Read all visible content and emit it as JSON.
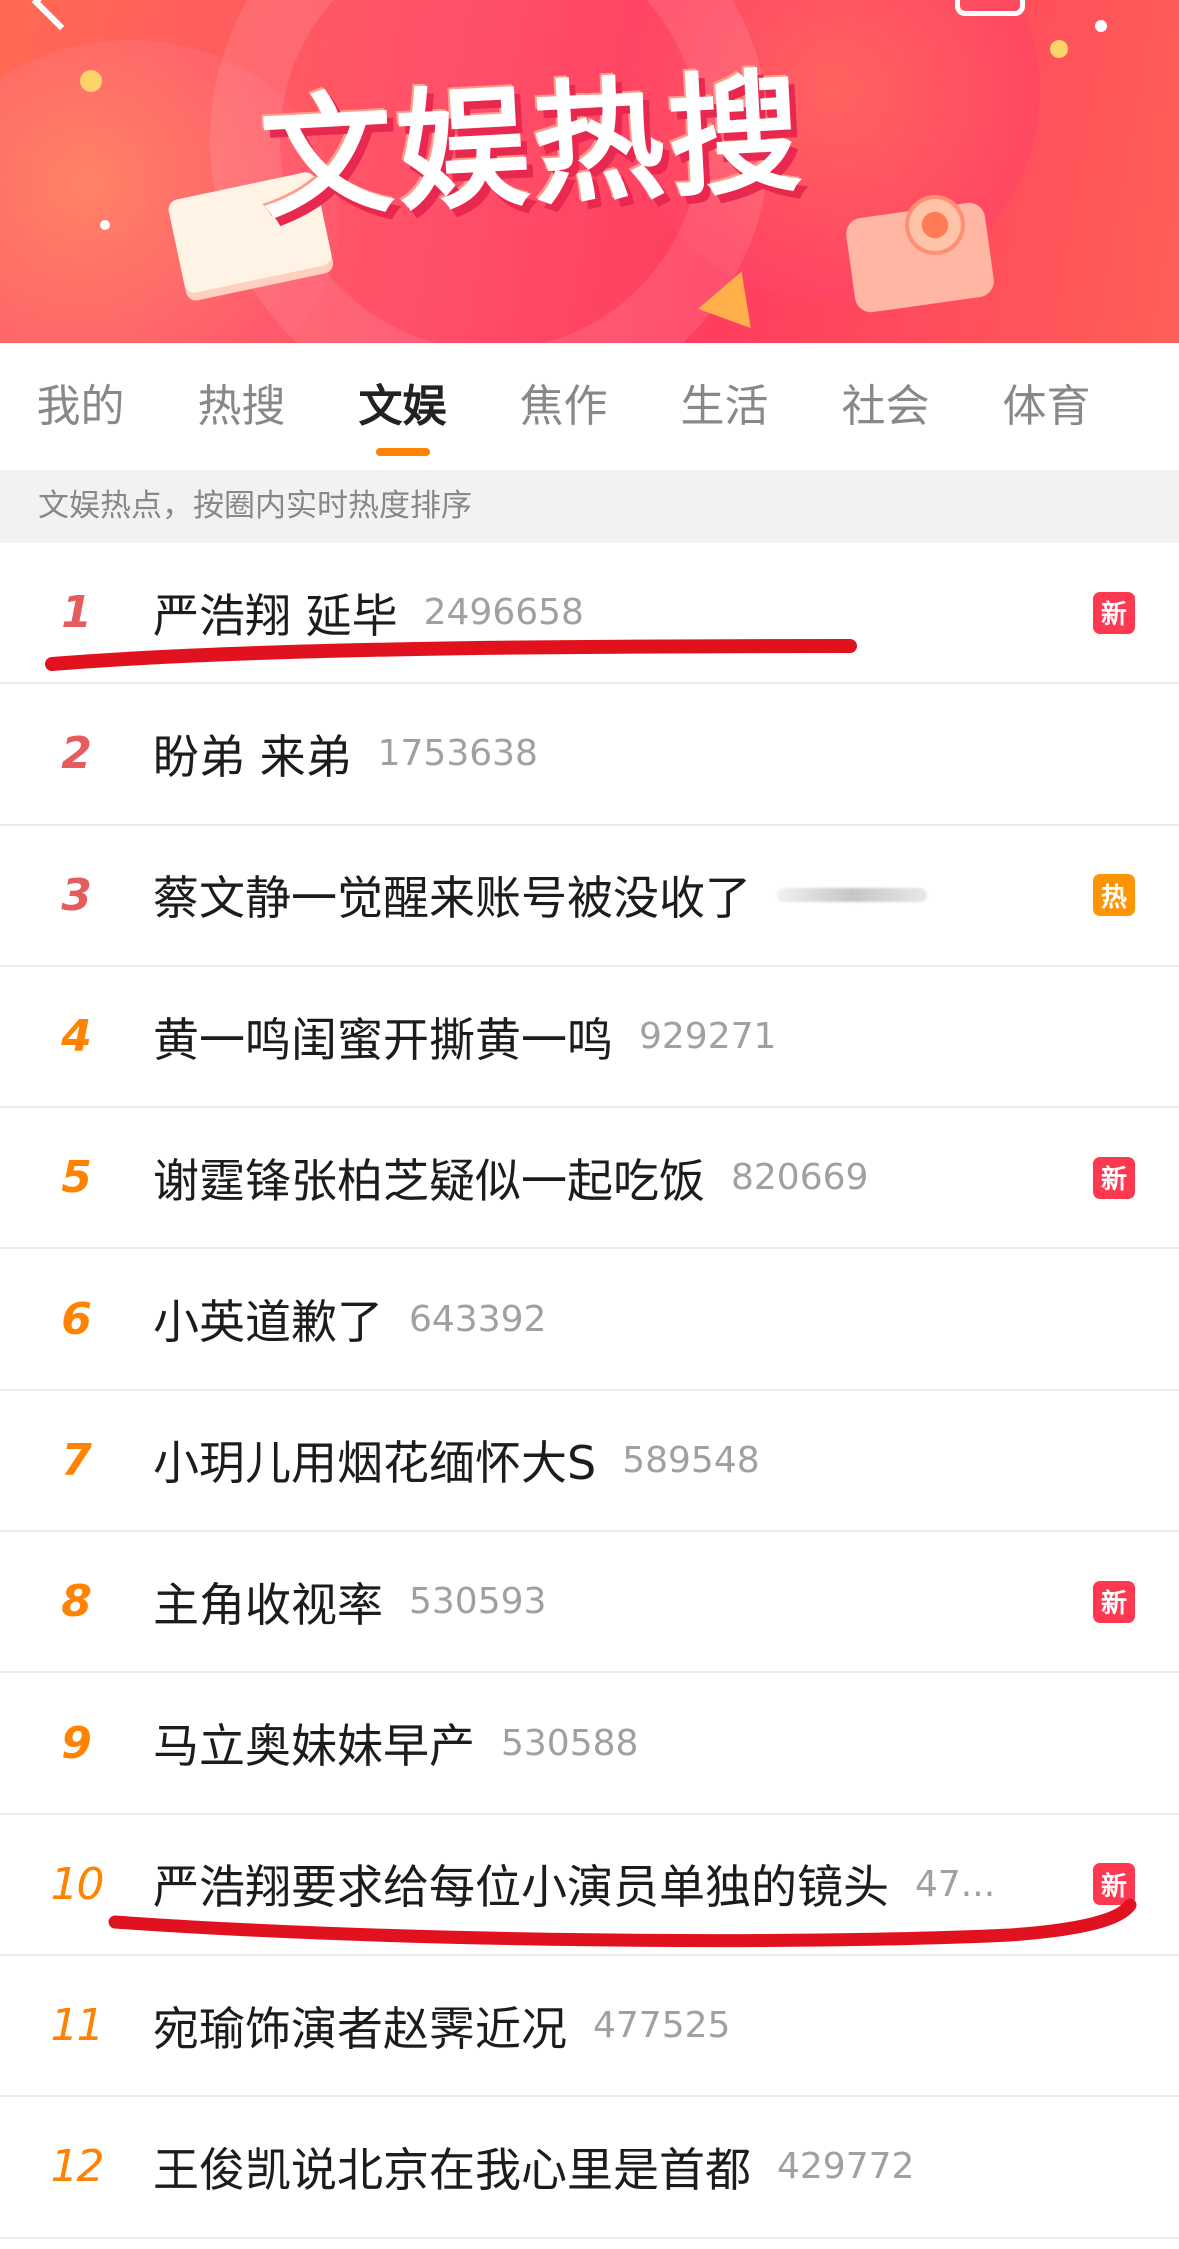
{
  "banner": {
    "title": "文娱热搜"
  },
  "tabs": [
    {
      "label": "我的"
    },
    {
      "label": "热搜"
    },
    {
      "label": "文娱",
      "active": true
    },
    {
      "label": "焦作"
    },
    {
      "label": "生活"
    },
    {
      "label": "社会"
    },
    {
      "label": "体育"
    }
  ],
  "subheader": "文娱热点，按圈内实时热度排序",
  "items": [
    {
      "rank": "1",
      "title": "严浩翔 延毕",
      "count": "2496658",
      "badge": "新"
    },
    {
      "rank": "2",
      "title": "盼弟 来弟",
      "count": "1753638",
      "badge": ""
    },
    {
      "rank": "3",
      "title": "蔡文静一觉醒来账号被没收了",
      "count": "",
      "badge": "热"
    },
    {
      "rank": "4",
      "title": "黄一鸣闺蜜开撕黄一鸣",
      "count": "929271",
      "badge": ""
    },
    {
      "rank": "5",
      "title": "谢霆锋张柏芝疑似一起吃饭",
      "count": "820669",
      "badge": "新"
    },
    {
      "rank": "6",
      "title": "小英道歉了",
      "count": "643392",
      "badge": ""
    },
    {
      "rank": "7",
      "title": "小玥儿用烟花缅怀大S",
      "count": "589548",
      "badge": ""
    },
    {
      "rank": "8",
      "title": "主角收视率",
      "count": "530593",
      "badge": "新"
    },
    {
      "rank": "9",
      "title": "马立奥妹妹早产",
      "count": "530588",
      "badge": ""
    },
    {
      "rank": "10",
      "title": "严浩翔要求给每位小演员单独的镜头",
      "count": "47...",
      "badge": "新"
    },
    {
      "rank": "11",
      "title": "宛瑜饰演者赵霁近况",
      "count": "477525",
      "badge": ""
    },
    {
      "rank": "12",
      "title": "王俊凯说北京在我心里是首都",
      "count": "429772",
      "badge": ""
    }
  ],
  "colors": {
    "accent": "#ff8200",
    "rank_top": "#e55c5c",
    "badge_new": "#ff3852",
    "badge_hot": "#ff9406",
    "annotation": "#e0121f"
  }
}
